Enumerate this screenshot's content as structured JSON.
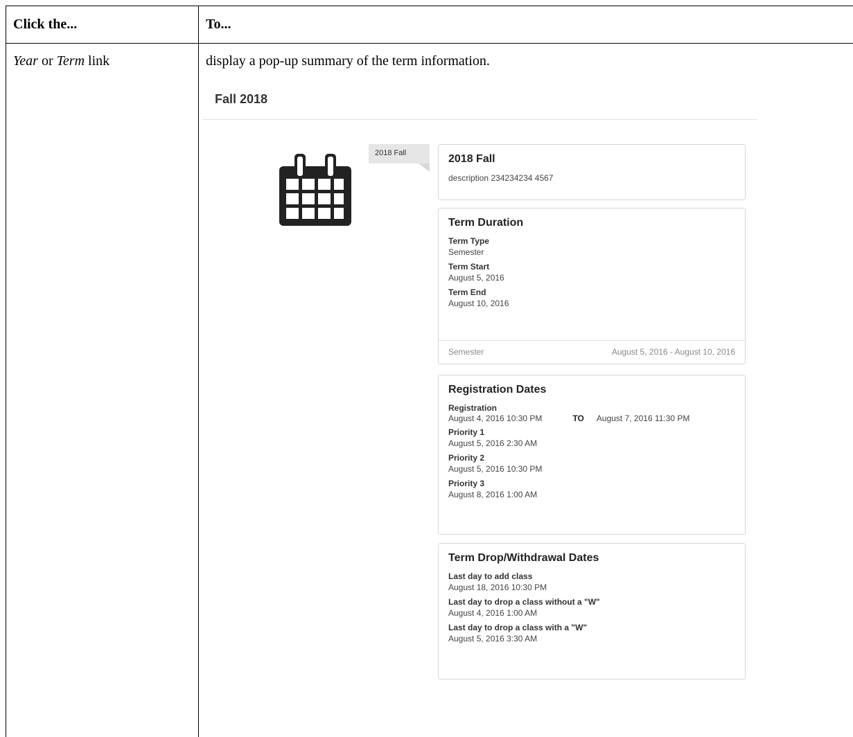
{
  "table": {
    "header": {
      "col1": "Click the...",
      "col2": "To..."
    },
    "row": {
      "col1_em1": "Year",
      "col1_mid": " or ",
      "col1_em2": "Term",
      "col1_tail": " link",
      "col2": "display a pop-up summary of the term information."
    }
  },
  "popup": {
    "title": "Fall 2018",
    "tag": "2018 Fall",
    "icon": "calendar-icon",
    "summary": {
      "heading": "2018 Fall",
      "description": "description 234234234 4567"
    },
    "duration": {
      "heading": "Term Duration",
      "fields": [
        {
          "label": "Term Type",
          "value": "Semester"
        },
        {
          "label": "Term Start",
          "value": "August 5, 2016"
        },
        {
          "label": "Term End",
          "value": "August 10, 2016"
        }
      ],
      "footer_left": "Semester",
      "footer_right": "August 5, 2016 - August 10, 2016"
    },
    "registration": {
      "heading": "Registration Dates",
      "range": {
        "label": "Registration",
        "start": "August 4, 2016 10:30 PM",
        "to": "TO",
        "end": "August 7, 2016 11:30 PM"
      },
      "fields": [
        {
          "label": "Priority 1",
          "value": "August 5, 2016 2:30 AM"
        },
        {
          "label": "Priority 2",
          "value": "August 5, 2016 10:30 PM"
        },
        {
          "label": "Priority 3",
          "value": "August 8, 2016 1:00 AM"
        }
      ]
    },
    "drop": {
      "heading": "Term Drop/Withdrawal Dates",
      "fields": [
        {
          "label": "Last day to add class",
          "value": "August 18, 2016 10:30 PM"
        },
        {
          "label": "Last day to drop a class without a \"W\"",
          "value": "August 4, 2016 1:00 AM"
        },
        {
          "label": "Last day to drop a class with a \"W\"",
          "value": "August 5, 2016 3:30 AM"
        }
      ]
    }
  }
}
